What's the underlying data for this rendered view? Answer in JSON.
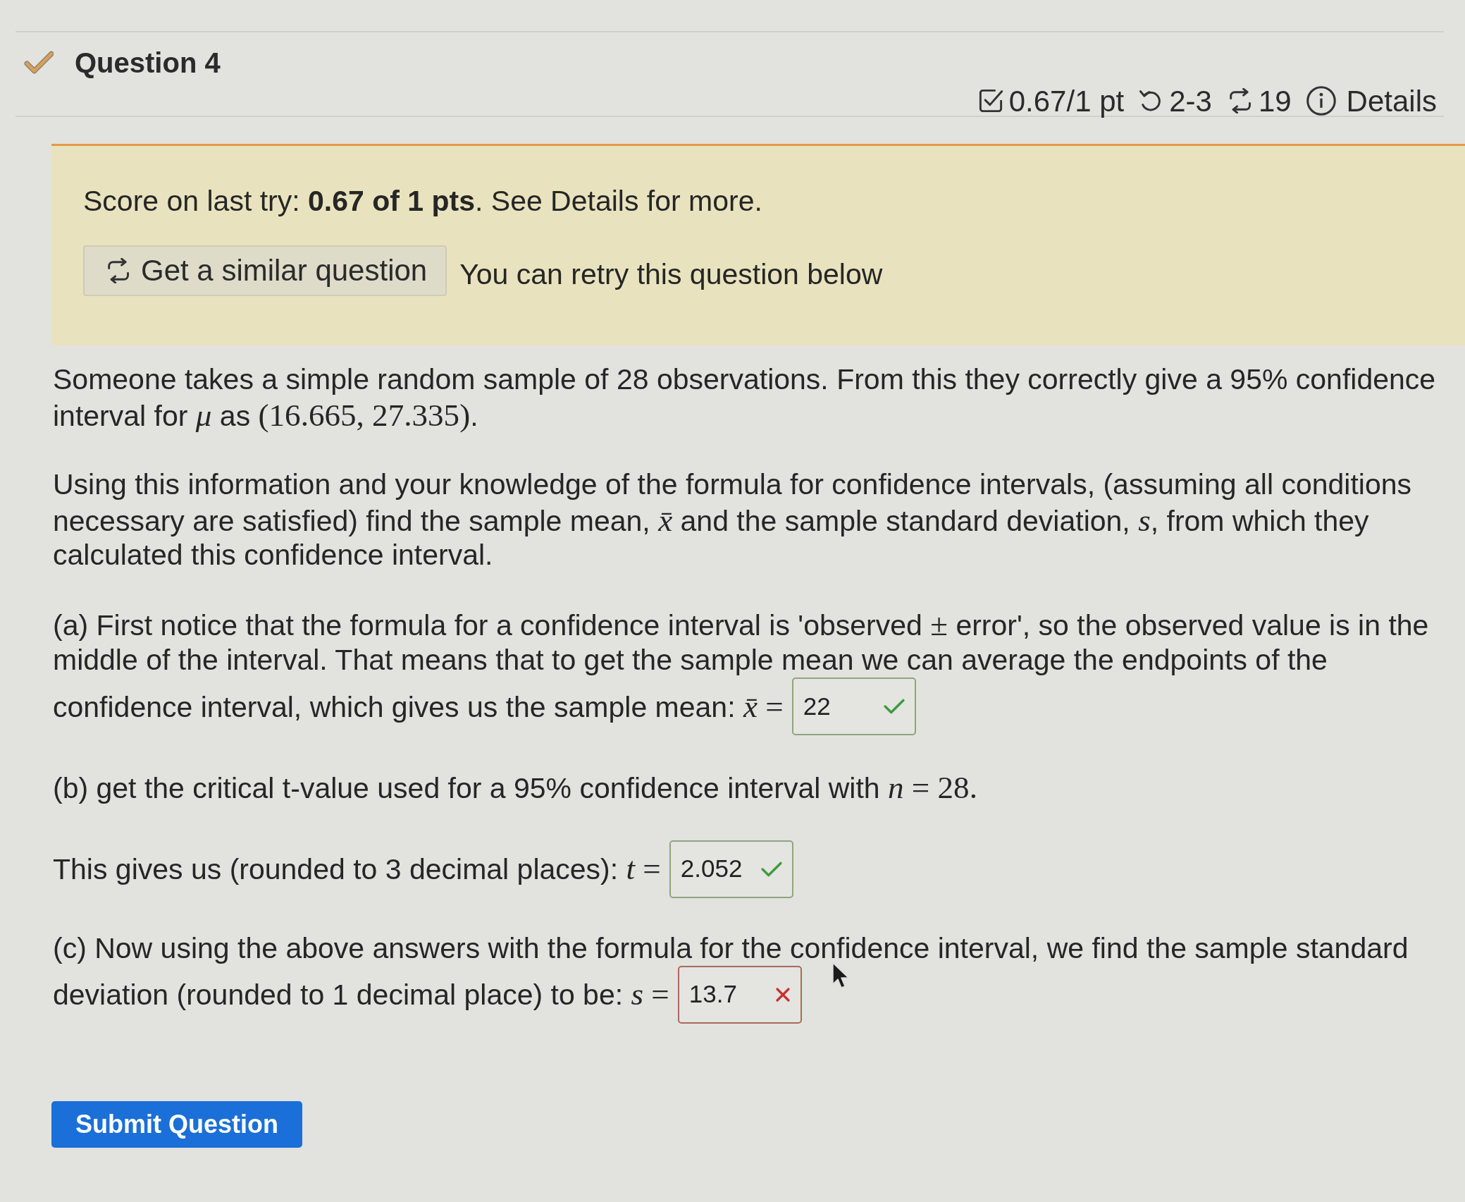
{
  "question": {
    "title": "Question 4",
    "partially_correct": true,
    "score": "0.67/1 pt",
    "attempts": "2-3",
    "versions": "19",
    "details_link": "Details"
  },
  "notice": {
    "text": "Score on last try: **0.67 of 1 pts**. See Details for more.",
    "similar_button": "Get a similar question",
    "retry_note": "You can retry this question below"
  },
  "paragraphs": [
    {
      "segments": [
        {
          "kind": "text",
          "text": "Someone takes a simple random sample of 28 observations. From this they correctly give a 95% confidence interval for "
        },
        {
          "kind": "var",
          "text": "μ"
        },
        {
          "kind": "text",
          "text": " as "
        },
        {
          "kind": "math",
          "text": "(16.665, 27.335)"
        },
        {
          "kind": "text",
          "text": "."
        }
      ]
    },
    {
      "segments": [
        {
          "kind": "text",
          "text": "Using this information and your knowledge of the formula for confidence intervals, (assuming all conditions necessary are satisfied) find the sample mean, "
        },
        {
          "kind": "var",
          "text": "x̄"
        },
        {
          "kind": "text",
          "text": " and the sample standard deviation, "
        },
        {
          "kind": "var",
          "text": "s"
        },
        {
          "kind": "text",
          "text": ", from which they calculated this confidence interval."
        }
      ]
    },
    {
      "segments": [
        {
          "kind": "text",
          "text": "(a) First notice that the formula for a confidence interval is 'observed "
        },
        {
          "kind": "math",
          "text": "±"
        },
        {
          "kind": "text",
          "text": " error', so the observed value is in the middle of the interval. That means that to get the sample mean we can average the endpoints of the"
        }
      ],
      "answer_line": [
        {
          "kind": "text",
          "text": "confidence interval, which gives us the sample mean: "
        },
        {
          "kind": "var",
          "text": "x̄"
        },
        {
          "kind": "math",
          "text": " ="
        }
      ],
      "answer": {
        "value": "22",
        "correct": true
      }
    },
    {
      "segments": [
        {
          "kind": "text",
          "text": "(b) get the critical t-value used for a 95% confidence interval with "
        },
        {
          "kind": "var",
          "text": "n"
        },
        {
          "kind": "math",
          "text": " = 28."
        }
      ]
    },
    {
      "answer_line": [
        {
          "kind": "text",
          "text": "This gives us (rounded to 3 decimal places): "
        },
        {
          "kind": "var",
          "text": "t"
        },
        {
          "kind": "math",
          "text": " ="
        }
      ],
      "answer": {
        "value": "2.052",
        "correct": true
      }
    },
    {
      "segments": [
        {
          "kind": "text",
          "text": "(c) Now using the above answers with the formula for the confidence interval, we find the sample standard"
        }
      ],
      "answer_line": [
        {
          "kind": "text",
          "text": "deviation (rounded to 1 decimal place) to be: "
        },
        {
          "kind": "var",
          "text": "s"
        },
        {
          "kind": "math",
          "text": " ="
        }
      ],
      "answer": {
        "value": "13.7",
        "correct": false
      }
    }
  ],
  "submit_button": "Submit Question"
}
